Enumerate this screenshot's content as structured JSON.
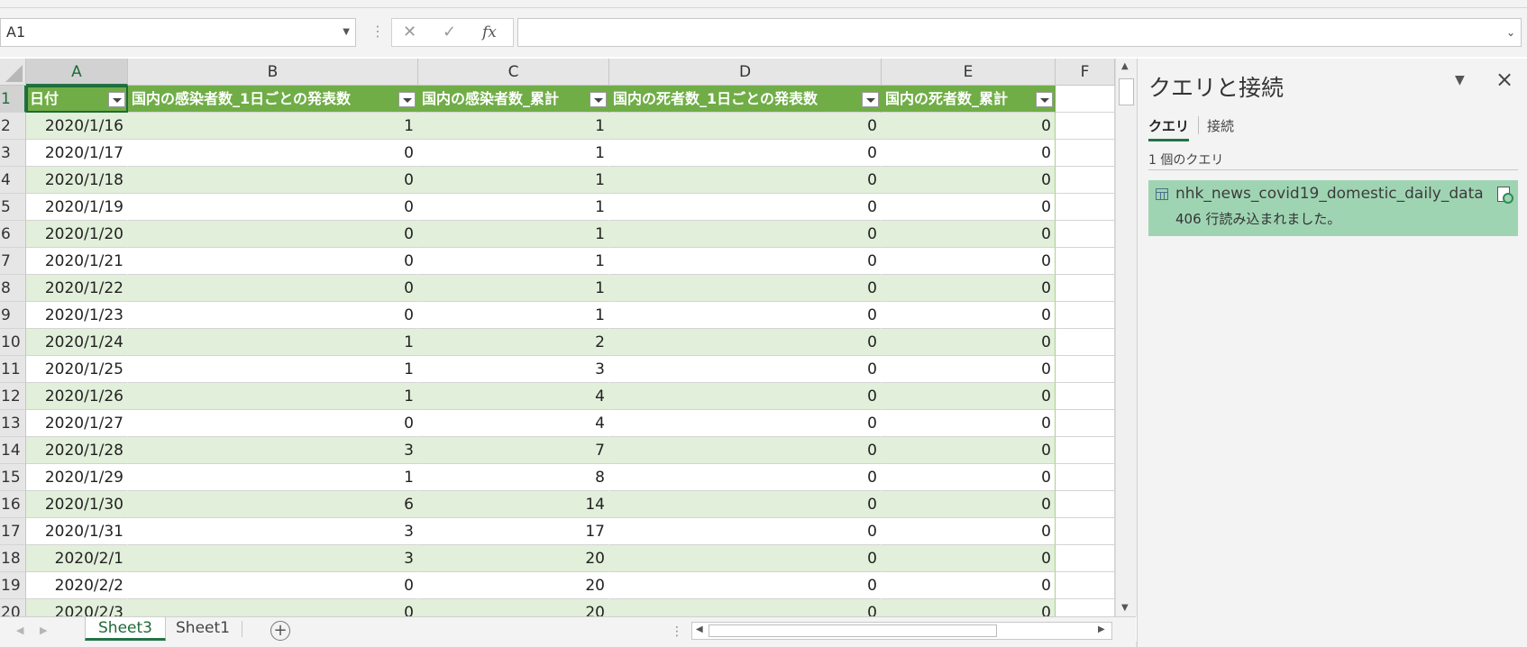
{
  "formula_bar": {
    "name_box": "A1",
    "cancel_glyph": "✕",
    "enter_glyph": "✓",
    "fx_label": "fx",
    "formula": ""
  },
  "grid": {
    "columns": [
      "A",
      "B",
      "C",
      "D",
      "E",
      "F"
    ],
    "row_numbers": [
      "1",
      "2",
      "3",
      "4",
      "5",
      "6",
      "7",
      "8",
      "9",
      "10",
      "11",
      "12",
      "13",
      "14",
      "15",
      "16",
      "17",
      "18",
      "19",
      "20"
    ],
    "headers": [
      "日付",
      "国内の感染者数_1日ごとの発表数",
      "国内の感染者数_累計",
      "国内の死者数_1日ごとの発表数",
      "国内の死者数_累計"
    ],
    "rows": [
      [
        "2020/1/16",
        "1",
        "1",
        "0",
        "0"
      ],
      [
        "2020/1/17",
        "0",
        "1",
        "0",
        "0"
      ],
      [
        "2020/1/18",
        "0",
        "1",
        "0",
        "0"
      ],
      [
        "2020/1/19",
        "0",
        "1",
        "0",
        "0"
      ],
      [
        "2020/1/20",
        "0",
        "1",
        "0",
        "0"
      ],
      [
        "2020/1/21",
        "0",
        "1",
        "0",
        "0"
      ],
      [
        "2020/1/22",
        "0",
        "1",
        "0",
        "0"
      ],
      [
        "2020/1/23",
        "0",
        "1",
        "0",
        "0"
      ],
      [
        "2020/1/24",
        "1",
        "2",
        "0",
        "0"
      ],
      [
        "2020/1/25",
        "1",
        "3",
        "0",
        "0"
      ],
      [
        "2020/1/26",
        "1",
        "4",
        "0",
        "0"
      ],
      [
        "2020/1/27",
        "0",
        "4",
        "0",
        "0"
      ],
      [
        "2020/1/28",
        "3",
        "7",
        "0",
        "0"
      ],
      [
        "2020/1/29",
        "1",
        "8",
        "0",
        "0"
      ],
      [
        "2020/1/30",
        "6",
        "14",
        "0",
        "0"
      ],
      [
        "2020/1/31",
        "3",
        "17",
        "0",
        "0"
      ],
      [
        "2020/2/1",
        "3",
        "20",
        "0",
        "0"
      ],
      [
        "2020/2/2",
        "0",
        "20",
        "0",
        "0"
      ],
      [
        "2020/2/3",
        "0",
        "20",
        "0",
        "0"
      ]
    ],
    "colors": {
      "header_fill": "#70ad47",
      "band_fill": "#e2efda",
      "accent": "#217346"
    }
  },
  "sheet_tabs": {
    "tabs": [
      "Sheet3",
      "Sheet1"
    ],
    "active": "Sheet3",
    "add_glyph": "+"
  },
  "task_pane": {
    "title": "クエリと接続",
    "tabs": [
      "クエリ",
      "接続"
    ],
    "query_count": "1 個のクエリ",
    "query": {
      "name": "nhk_news_covid19_domestic_daily_data",
      "status": "406 行読み込まれました。"
    },
    "selected_fill": "#9fd4b3"
  }
}
